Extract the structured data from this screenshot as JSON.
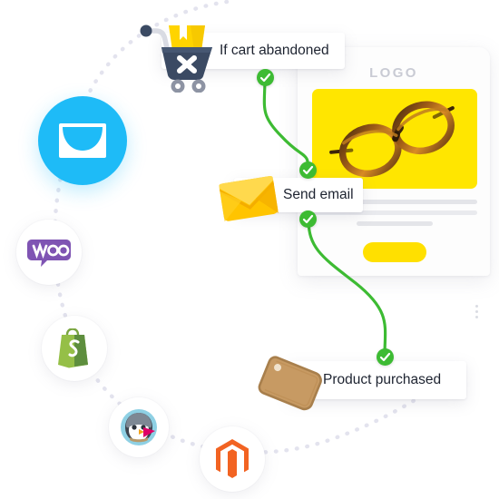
{
  "scene": {
    "title": "Ecommerce automation workflow illustration",
    "background_color": "#ffffff"
  },
  "workflow": {
    "steps": [
      {
        "id": "cart-abandoned",
        "label": "If cart abandoned",
        "icon": "shopping-cart-x-icon",
        "icon_colors": {
          "cart": "#3b4a63",
          "box": "#ffd400",
          "wheels": "#8d93a3"
        }
      },
      {
        "id": "send-email",
        "label": "Send email",
        "icon": "envelope-icon",
        "icon_colors": {
          "front": "#ffc400",
          "flap": "#ffd633"
        }
      },
      {
        "id": "product-purchased",
        "label": "Product purchased",
        "icon": "price-tag-icon",
        "icon_colors": {
          "tag": "#c79a63",
          "edge": "#a87f4c"
        }
      }
    ],
    "connectors": {
      "color": "#3dbb33",
      "badge_icon": "check-icon",
      "badge_count": 4
    }
  },
  "email_preview": {
    "logo_text": "LOGO",
    "hero": {
      "background_color": "#ffe600",
      "image": "eyeglasses-image"
    },
    "body_lines": 3,
    "cta": {
      "label": "",
      "color": "#ffe000"
    }
  },
  "integrations": {
    "path_style": "dotted",
    "path_color": "#e4e4ee",
    "items": [
      {
        "id": "campaign-monitor",
        "name": "Campaign Monitor",
        "icon": "envelope-icon",
        "accent": "#1ebbf7"
      },
      {
        "id": "woocommerce",
        "name": "WooCommerce",
        "icon": "woo-logo-icon",
        "accent": "#7f54b3"
      },
      {
        "id": "shopify",
        "name": "Shopify",
        "icon": "shopify-bag-icon",
        "accent": "#95bf47"
      },
      {
        "id": "prestashop",
        "name": "PrestaShop",
        "icon": "prestashop-mascot-icon",
        "accent": "#df0067"
      },
      {
        "id": "magento",
        "name": "Magento",
        "icon": "magento-logo-icon",
        "accent": "#f26322"
      }
    ]
  }
}
